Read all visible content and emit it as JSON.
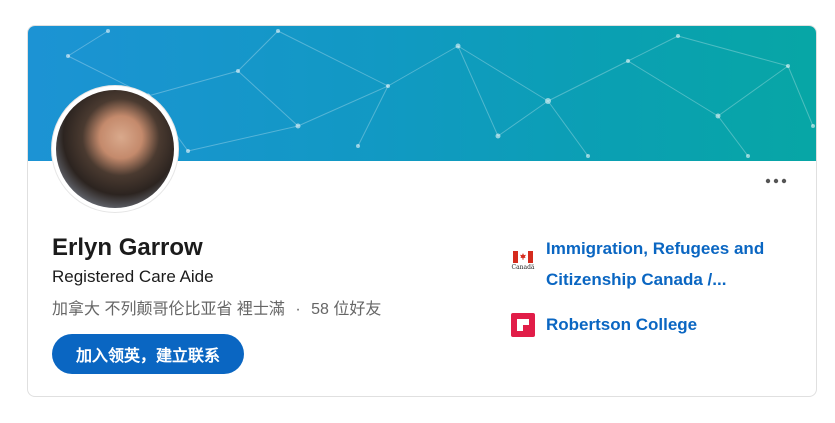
{
  "profile": {
    "name": "Erlyn Garrow",
    "headline": "Registered Care Aide",
    "location": "加拿大 不列颠哥伦比亚省 裡士滿",
    "separator": "·",
    "connections": "58 位好友"
  },
  "actions": {
    "join_label": "加入领英，建立联系",
    "more_icon": "more-horizontal-icon"
  },
  "experience": [
    {
      "name": "Immigration, Refugees and Citizenship Canada /...",
      "logo": "canada-flag-logo",
      "logo_text": "Canadä"
    },
    {
      "name": "Robertson College",
      "logo": "robertson-college-logo"
    }
  ],
  "colors": {
    "accent": "#0a66c2",
    "banner_start": "#1c93d4",
    "banner_end": "#07a6a5",
    "robertson_red": "#e11d48"
  }
}
